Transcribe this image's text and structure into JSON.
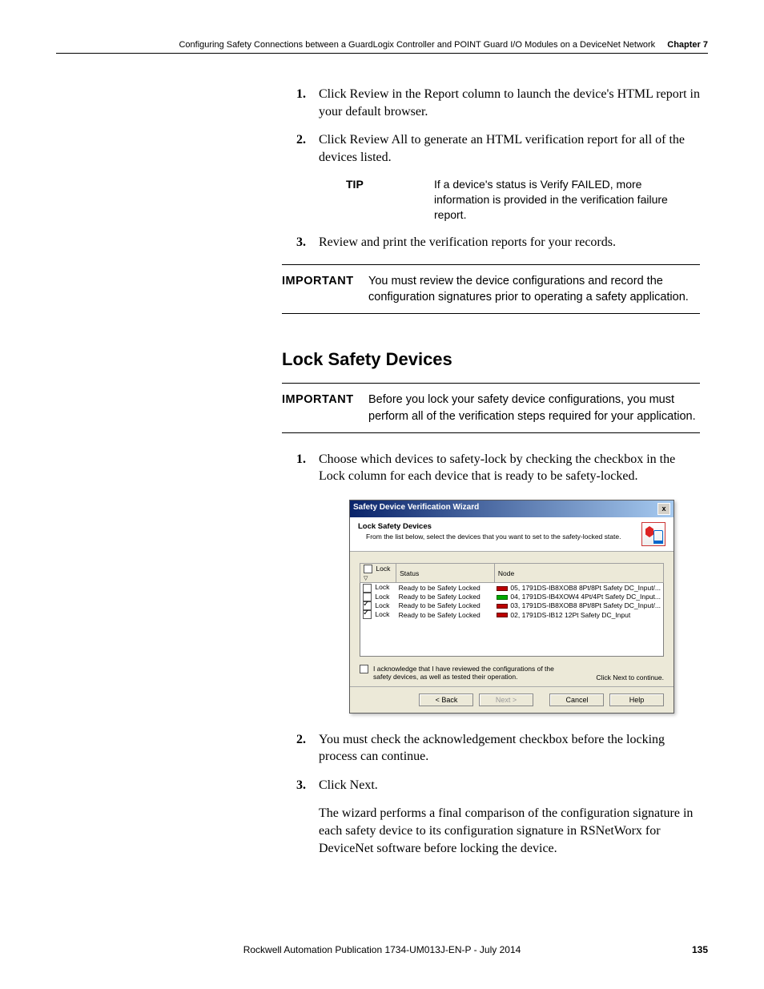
{
  "header": {
    "title": "Configuring Safety Connections between a GuardLogix Controller and POINT Guard I/O Modules on a DeviceNet Network",
    "chapter": "Chapter 7"
  },
  "steps_a": [
    {
      "n": "1.",
      "t": "Click Review in the Report column to launch the device's HTML report in your default browser."
    },
    {
      "n": "2.",
      "t": "Click Review All to generate an HTML verification report for all of the devices listed."
    }
  ],
  "tip": {
    "label": "TIP",
    "text": "If a device's status is Verify FAILED, more information is provided in the verification failure report."
  },
  "step_a3": {
    "n": "3.",
    "t": "Review and print the verification reports for your records."
  },
  "important1": {
    "label": "IMPORTANT",
    "text": "You must review the device configurations and record the configuration signatures prior to operating a safety application."
  },
  "section_heading": "Lock Safety Devices",
  "important2": {
    "label": "IMPORTANT",
    "text": "Before you lock your safety device configurations, you must perform all of the verification steps required for your application."
  },
  "step_b1": {
    "n": "1.",
    "t": "Choose which devices to safety-lock by checking the checkbox in the Lock column for each device that is ready to be safety-locked."
  },
  "wizard": {
    "title": "Safety Device Verification Wizard",
    "close": "x",
    "head_title": "Lock Safety Devices",
    "head_sub": "From the list below, select the devices that you want to set to the safety-locked state.",
    "cols": {
      "lock": "Lock",
      "status": "Status",
      "node": "Node"
    },
    "rows": [
      {
        "checked": false,
        "status": "Ready to be Safety Locked",
        "node": "05, 1791DS-IB8XOB8 8Pt/8Pt Safety DC_Input/..."
      },
      {
        "checked": false,
        "status": "Ready to be Safety Locked",
        "node": "04, 1791DS-IB4XOW4 4Pt/4Pt Safety DC_Input..."
      },
      {
        "checked": true,
        "status": "Ready to be Safety Locked",
        "node": "03, 1791DS-IB8XOB8 8Pt/8Pt Safety DC_Input/..."
      },
      {
        "checked": true,
        "status": "Ready to be Safety Locked",
        "node": "02, 1791DS-IB12 12Pt Safety DC_Input"
      }
    ],
    "ack": "I acknowledge that I have reviewed the configurations of the safety devices, as well as tested their operation.",
    "hint": "Click Next to continue.",
    "buttons": {
      "back": "< Back",
      "next": "Next >",
      "cancel": "Cancel",
      "help": "Help"
    }
  },
  "step_b2": {
    "n": "2.",
    "t": "You must check the acknowledgement checkbox before the locking process can continue."
  },
  "step_b3": {
    "n": "3.",
    "t": "Click Next."
  },
  "follow": "The wizard performs a final comparison of the configuration signature in each safety device to its configuration signature in RSNetWorx for DeviceNet software before locking the device.",
  "footer": {
    "pub": "Rockwell Automation Publication 1734-UM013J-EN-P - July 2014",
    "page": "135"
  }
}
